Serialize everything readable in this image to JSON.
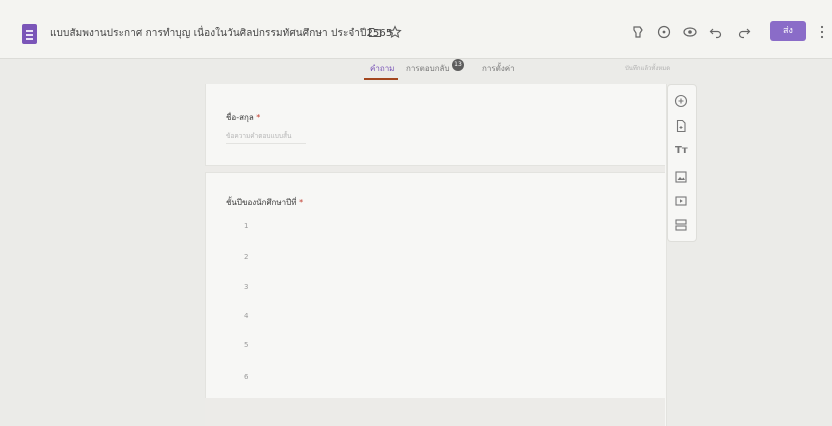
{
  "app": {
    "title": "แบบสัมพงานประกาศ การทำบุญ เนื่องในวันศิลปกรรมทัศนศึกษา ประจำปี2565",
    "icons": {
      "logo": "google-forms-logo",
      "folder": "folder-icon",
      "star": "star-icon"
    }
  },
  "toolbar": {
    "icons": [
      "customize-theme-icon",
      "preview-eye-icon",
      "palette-icon",
      "undo-icon",
      "redo-icon"
    ],
    "send_label": "ส่ง",
    "more": "more-vert-icon"
  },
  "tabs": [
    {
      "label": "คำถาม",
      "active": true
    },
    {
      "label": "การตอบกลับ",
      "badge": "13"
    },
    {
      "label": "การตั้งค่า"
    }
  ],
  "status": {
    "saved": "บันทึกแล้วทั้งหมด"
  },
  "questions": [
    {
      "title": "ชื่อ-สกุล",
      "required": "*",
      "placeholder": "ข้อความคำตอบแบบสั้น"
    },
    {
      "title": "ชั้นปีของนักศึกษาปีที่",
      "required": "*",
      "options": [
        "1",
        "2",
        "3",
        "4",
        "5",
        "6"
      ]
    }
  ],
  "side_tools": [
    "add-question-icon",
    "import-questions-icon",
    "add-title-icon",
    "add-image-icon",
    "add-video-icon",
    "add-section-icon"
  ],
  "side_tools_tt": "Tт"
}
